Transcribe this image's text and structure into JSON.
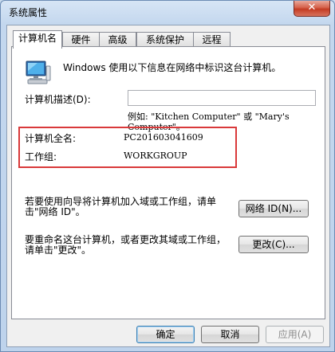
{
  "window": {
    "title": "系统属性",
    "close_glyph": "✕"
  },
  "tabs": [
    {
      "label": "计算机名",
      "active": true
    },
    {
      "label": "硬件",
      "active": false
    },
    {
      "label": "高级",
      "active": false
    },
    {
      "label": "系统保护",
      "active": false
    },
    {
      "label": "远程",
      "active": false
    }
  ],
  "computer_name_tab": {
    "intro": "Windows 使用以下信息在网络中标识这台计算机。",
    "description_label": "计算机描述(D):",
    "description_value": "",
    "example_line1": "例如: \"Kitchen Computer\" 或 \"Mary's",
    "example_line2": "Computer\"。",
    "full_name_label": "计算机全名:",
    "full_name_value": "PC201603041609",
    "workgroup_label": "工作组:",
    "workgroup_value": "WORKGROUP",
    "network_id_text_line1": "若要使用向导将计算机加入域或工作组，请单",
    "network_id_text_line2": "击\"网络 ID\"。",
    "network_id_button": "网络 ID(N)...",
    "rename_text_line1": "要重命名这台计算机，或者更改其域或工作组，",
    "rename_text_line2": "请单击\"更改\"。",
    "change_button": "更改(C)..."
  },
  "footer": {
    "ok": "确定",
    "cancel": "取消",
    "apply": "应用(A)"
  },
  "colors": {
    "highlight_box": "#d9393a",
    "title_gradient_top": "#d7e5f5"
  }
}
